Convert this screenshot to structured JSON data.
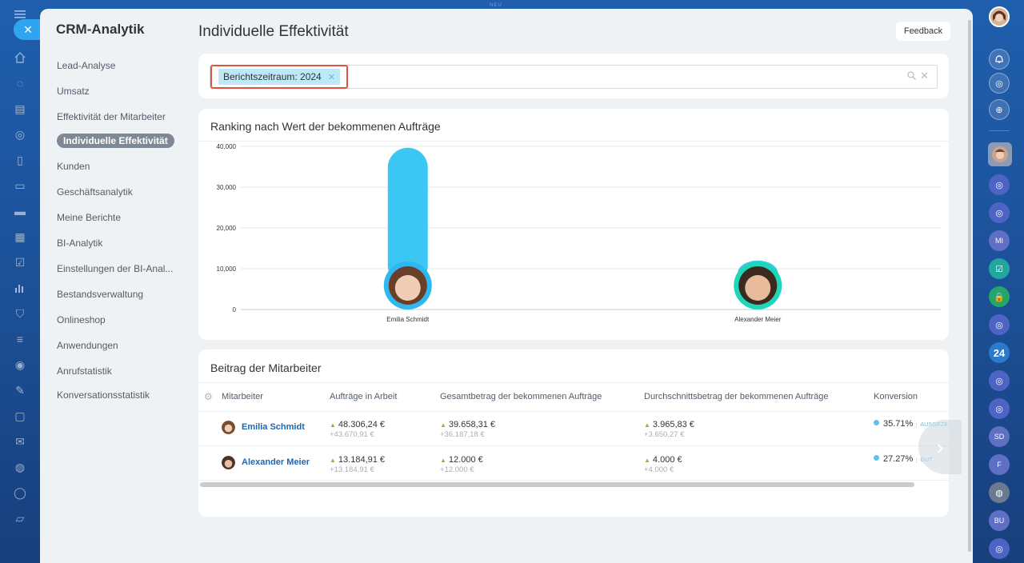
{
  "top_label": "NEU",
  "nav": {
    "title": "CRM-Analytik",
    "items": [
      {
        "label": "Lead-Analyse",
        "active": false
      },
      {
        "label": "Umsatz",
        "active": false
      },
      {
        "label": "Effektivität der Mitarbeiter",
        "active": false
      },
      {
        "label": "Individuelle Effektivität",
        "active": true
      },
      {
        "label": "Kunden",
        "active": false
      },
      {
        "label": "Geschäftsanalytik",
        "active": false
      },
      {
        "label": "Meine Berichte",
        "active": false
      },
      {
        "label": "BI-Analytik",
        "active": false
      },
      {
        "label": "Einstellungen der BI-Anal...",
        "active": false
      },
      {
        "label": "Bestandsverwaltung",
        "active": false
      },
      {
        "label": "Onlineshop",
        "active": false
      },
      {
        "label": "Anwendungen",
        "active": false
      },
      {
        "label": "Anrufstatistik",
        "active": false
      },
      {
        "label": "Konversationsstatistik",
        "active": false
      }
    ]
  },
  "header": {
    "title": "Individuelle Effektivität",
    "feedback_label": "Feedback"
  },
  "filter": {
    "tag_label": "Berichtszeitraum: 2024"
  },
  "chart": {
    "title": "Ranking nach Wert der bekommenen Aufträge",
    "colors": {
      "bar": "#3cc6f4",
      "ring_1": "#2fb8ef",
      "ring_2": "#1fd6b8",
      "grid": "#e4e7ea",
      "axis": "#c8ccd0"
    }
  },
  "chart_data": {
    "type": "bar",
    "categories": [
      "Emilia Schmidt",
      "Alexander Meier"
    ],
    "values": [
      39658.31,
      12000
    ],
    "yticks": [
      "0",
      "10,000",
      "20,000",
      "30,000",
      "40,000"
    ],
    "ylim": [
      0,
      40000
    ],
    "grid": true
  },
  "table": {
    "title": "Beitrag der Mitarbeiter",
    "columns": [
      "Mitarbeiter",
      "Aufträge in Arbeit",
      "Gesamtbetrag der bekommenen Aufträge",
      "Durchschnittsbetrag der bekommenen Aufträge",
      "Konversion"
    ],
    "rows": [
      {
        "name": "Emilia Schmidt",
        "in_work": "48.306,24 €",
        "in_work_delta": "+43.670,91 €",
        "total": "39.658,31 €",
        "total_delta": "+36.187,18 €",
        "avg": "3.965,83 €",
        "avg_delta": "+3.650,27 €",
        "conversion": "35.71%",
        "conversion_tag": "AUSGEZE"
      },
      {
        "name": "Alexander Meier",
        "in_work": "13.184,91 €",
        "in_work_delta": "+13.184,91 €",
        "total": "12.000 €",
        "total_delta": "+12.000 €",
        "avg": "4.000 €",
        "avg_delta": "+4.000 €",
        "conversion": "27.27%",
        "conversion_tag": "GUT"
      }
    ]
  },
  "right_rail": {
    "badge_24": "24",
    "initials": [
      "MI",
      "SD",
      "F",
      "BU"
    ]
  }
}
